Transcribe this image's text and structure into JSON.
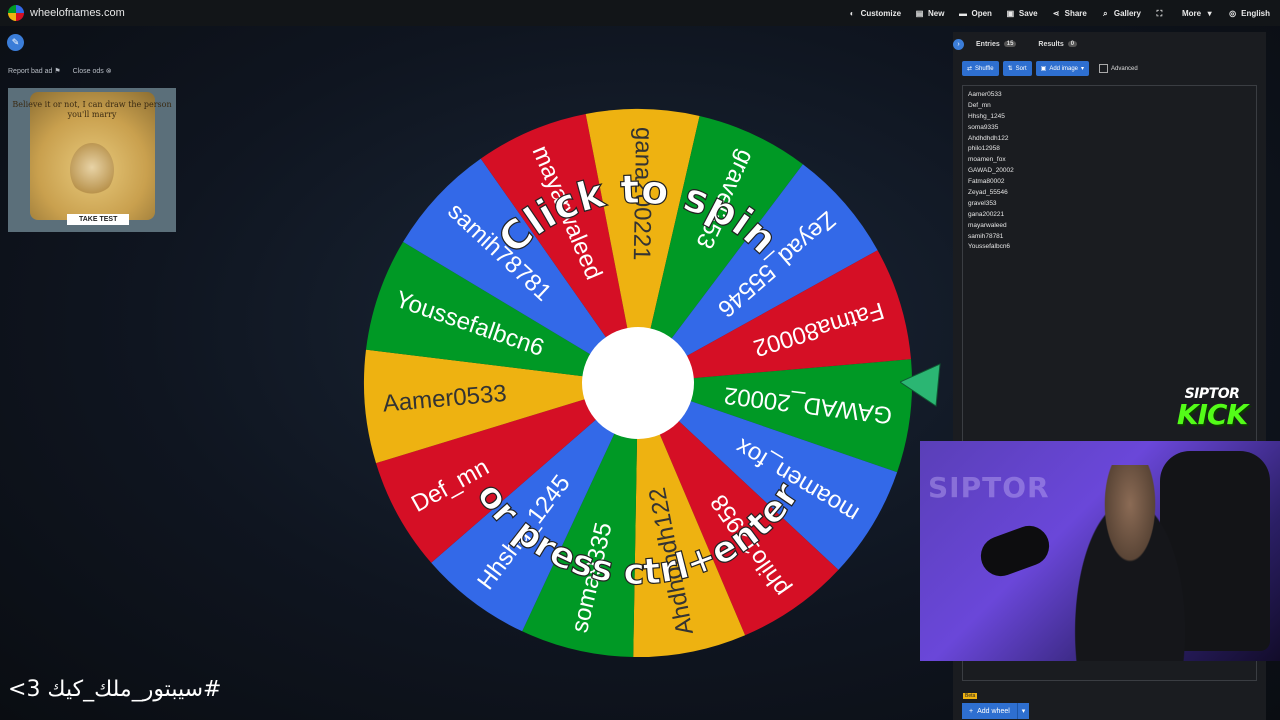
{
  "brand": {
    "name": "wheelofnames.com"
  },
  "menu": [
    {
      "label": "Customize",
      "icon": "palette-icon"
    },
    {
      "label": "New",
      "icon": "file-icon"
    },
    {
      "label": "Open",
      "icon": "folder-icon"
    },
    {
      "label": "Save",
      "icon": "save-icon"
    },
    {
      "label": "Share",
      "icon": "share-icon"
    },
    {
      "label": "Gallery",
      "icon": "search-icon"
    },
    {
      "label": "",
      "icon": "fullscreen-icon"
    },
    {
      "label": "More",
      "icon": "chevron-down-icon"
    },
    {
      "label": "English",
      "icon": "globe-icon"
    }
  ],
  "ads": {
    "report": "Report bad ad",
    "close": "Close ods",
    "banner_text": "Believe it or not, I can draw the person you'll marry",
    "banner_button": "TAKE TEST"
  },
  "wheel": {
    "overlay_top": "Click to spin",
    "overlay_bottom": "or press ctrl+enter",
    "colors": [
      "#009925",
      "#3369e8",
      "#d50f25",
      "#eeb211"
    ],
    "segments": [
      "GAWAD_20002",
      "moamen_fox",
      "philo12958",
      "Ahdhdhdh122",
      "soma9335",
      "Hhshg_1245",
      "Def_mn",
      "Aamer0533",
      "Youssefalbcn6",
      "samih78781",
      "mayarwaleed",
      "gana200221",
      "gravel353",
      "Zeyad_55546",
      "Fatma80002"
    ]
  },
  "panel": {
    "tabs": [
      {
        "label": "Entries",
        "count": "15"
      },
      {
        "label": "Results",
        "count": "0"
      }
    ],
    "tools": {
      "shuffle": "Shuffle",
      "sort": "Sort",
      "add_image": "Add image",
      "advanced": "Advanced"
    },
    "entries": [
      "Aamer0533",
      "Def_mn",
      "Hhshg_1245",
      "soma9335",
      "Ahdhdhdh122",
      "philo12958",
      "moamen_fox",
      "GAWAD_20002",
      "Fatma80002",
      "Zeyad_55546",
      "gravel353",
      "gana200221",
      "mayarwaleed",
      "samih78781",
      "Youssefalbcn6"
    ],
    "beta": "Beta",
    "add_wheel": "Add wheel"
  },
  "stream": {
    "logo_top": "SIPTOR",
    "logo_main": "KICK",
    "neon_sign": "SIPTOR",
    "caption": "#سيبتور_ملك_كيك 3>"
  }
}
